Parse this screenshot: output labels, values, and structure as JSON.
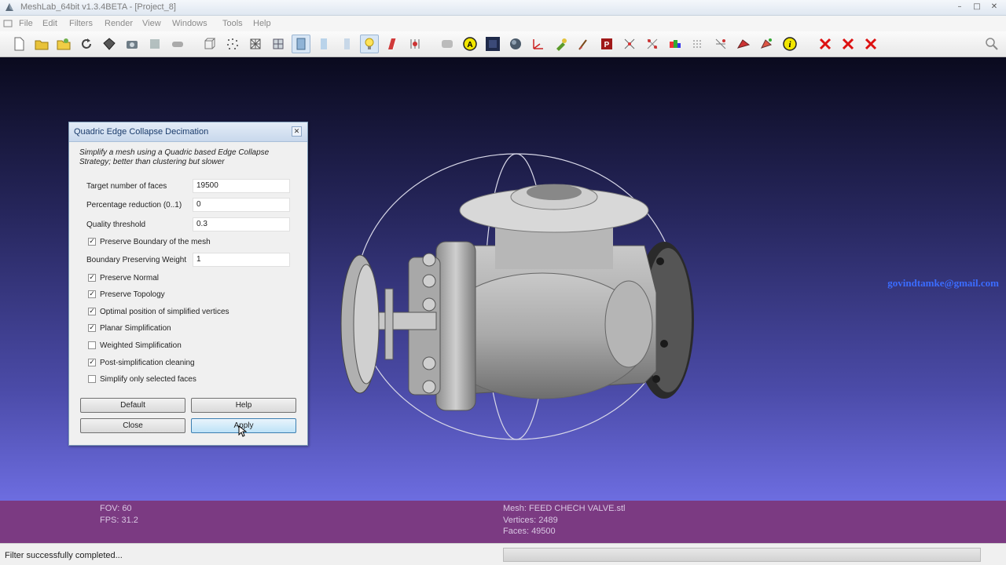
{
  "window": {
    "title": "MeshLab_64bit v1.3.4BETA - [Project_8]",
    "controls": [
      "minimize-icon",
      "maximize-icon",
      "close-icon"
    ]
  },
  "menu": {
    "items": [
      "File",
      "Edit",
      "Filters",
      "Render",
      "View",
      "Windows",
      "Tools",
      "Help"
    ]
  },
  "toolbar": {
    "icons": [
      "new-project-icon",
      "open-project-icon",
      "open-mesh-icon",
      "reload-icon",
      "export-mesh-icon",
      "snapshot-icon",
      "save-icon",
      "close-mesh-icon",
      "bounding-box-icon",
      "points-render-icon",
      "wireframe-icon",
      "hidden-lines-icon",
      "flat-shading-icon",
      "flat-lines-icon",
      "smooth-shading-icon",
      "light-icon",
      "fancy-lighting-icon",
      "backface-culling-icon",
      "info-plugin-icon",
      "annotation-icon",
      "texture-icon",
      "sphere-icon",
      "axis-icon",
      "paint-icon",
      "brush-icon",
      "layer-icon",
      "select-vertices-icon",
      "select-faces-icon",
      "color-icon",
      "select-edit-icon",
      "align-icon",
      "measure-icon",
      "point-picking-icon",
      "info-icon",
      "delete-selection-icon",
      "delete-faces-icon",
      "delete-vertices-icon"
    ],
    "search_icon": "magnifier-icon"
  },
  "viewport": {
    "email": "govindtamke@gmail.com",
    "model": "feed-check-valve"
  },
  "info": {
    "fov": "FOV: 60",
    "fps": "FPS:   31.2",
    "mesh": "Mesh: FEED CHECH VALVE.stl",
    "vertices": "Vertices: 2489",
    "faces": "Faces: 49500"
  },
  "status": {
    "text": "Filter successfully completed...",
    "progress": 0
  },
  "dialog": {
    "title": "Quadric Edge Collapse Decimation",
    "description": "Simplify a mesh using a Quadric based Edge Collapse Strategy; better than clustering but slower",
    "fields": [
      {
        "label": "Target number of faces",
        "value": "19500"
      },
      {
        "label": "Percentage reduction (0..1)",
        "value": "0"
      },
      {
        "label": "Quality threshold",
        "value": "0.3"
      }
    ],
    "preserve_boundary": {
      "label": "Preserve Boundary of the mesh",
      "checked": true
    },
    "boundary_weight": {
      "label": "Boundary Preserving Weight",
      "value": "1"
    },
    "checkboxes": [
      {
        "label": "Preserve Normal",
        "checked": true
      },
      {
        "label": "Preserve Topology",
        "checked": true
      },
      {
        "label": "Optimal position of simplified vertices",
        "checked": true
      },
      {
        "label": "Planar Simplification",
        "checked": true
      },
      {
        "label": "Weighted Simplification",
        "checked": false
      },
      {
        "label": "Post-simplification cleaning",
        "checked": true
      },
      {
        "label": "Simplify only selected faces",
        "checked": false
      }
    ],
    "buttons": {
      "default": "Default",
      "help": "Help",
      "close": "Close",
      "apply": "Apply"
    }
  }
}
